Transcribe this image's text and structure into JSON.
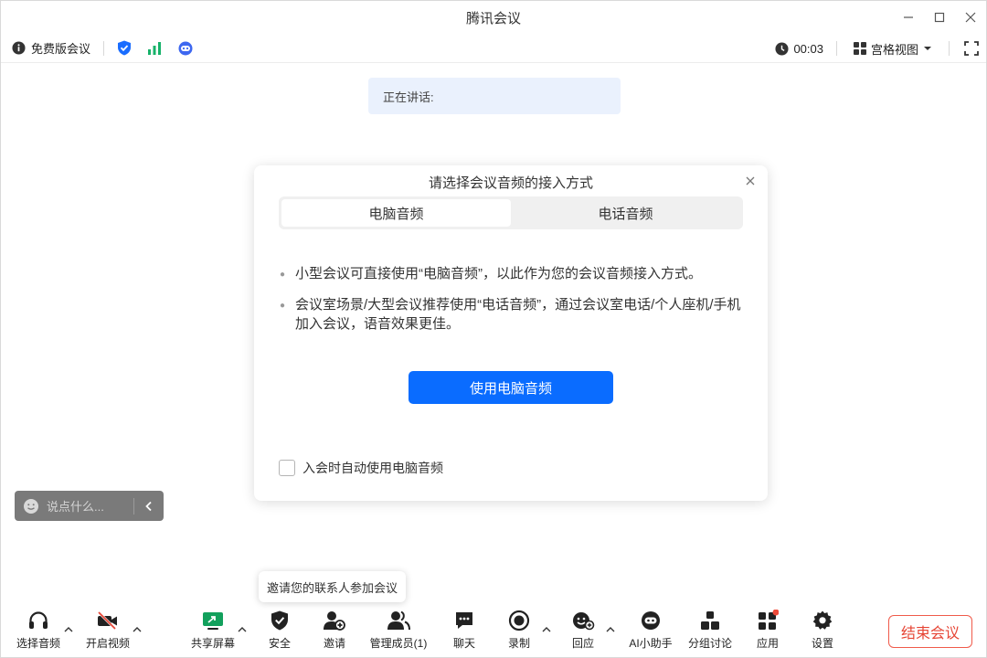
{
  "window": {
    "title": "腾讯会议"
  },
  "infobar": {
    "meeting_type": "免费版会议",
    "timer": "00:03",
    "view_label": "宫格视图"
  },
  "speaking": {
    "label": "正在讲话:"
  },
  "dialog": {
    "title": "请选择会议音频的接入方式",
    "tabs": [
      {
        "label": "电脑音频"
      },
      {
        "label": "电话音频"
      }
    ],
    "bullets": [
      "小型会议可直接使用“电脑音频”，以此作为您的会议音频接入方式。",
      "会议室场景/大型会议推荐使用“电话音频”，通过会议室电话/个人座机/手机加入会议，语音效果更佳。"
    ],
    "primary_button": "使用电脑音频",
    "checkbox_label": "入会时自动使用电脑音频"
  },
  "chat": {
    "placeholder": "说点什么..."
  },
  "tooltip": {
    "text": "邀请您的联系人参加会议"
  },
  "toolbar": {
    "items": [
      {
        "label": "选择音频",
        "icon": "headset-icon"
      },
      {
        "label": "开启视频",
        "icon": "camera-off-icon"
      },
      {
        "label": "共享屏幕",
        "icon": "share-screen-icon"
      },
      {
        "label": "安全",
        "icon": "shield-icon"
      },
      {
        "label": "邀请",
        "icon": "add-user-icon"
      },
      {
        "label": "管理成员(1)",
        "icon": "members-icon"
      },
      {
        "label": "聊天",
        "icon": "chat-icon"
      },
      {
        "label": "录制",
        "icon": "record-icon"
      },
      {
        "label": "回应",
        "icon": "reaction-icon"
      },
      {
        "label": "AI小助手",
        "icon": "ai-assistant-icon"
      },
      {
        "label": "分组讨论",
        "icon": "breakout-icon"
      },
      {
        "label": "应用",
        "icon": "apps-icon"
      },
      {
        "label": "设置",
        "icon": "settings-icon"
      }
    ],
    "end_label": "结束会议"
  },
  "colors": {
    "primary": "#0a6cff",
    "danger": "#e64535",
    "share_green": "#12a05c",
    "signal_green": "#17b26a"
  }
}
